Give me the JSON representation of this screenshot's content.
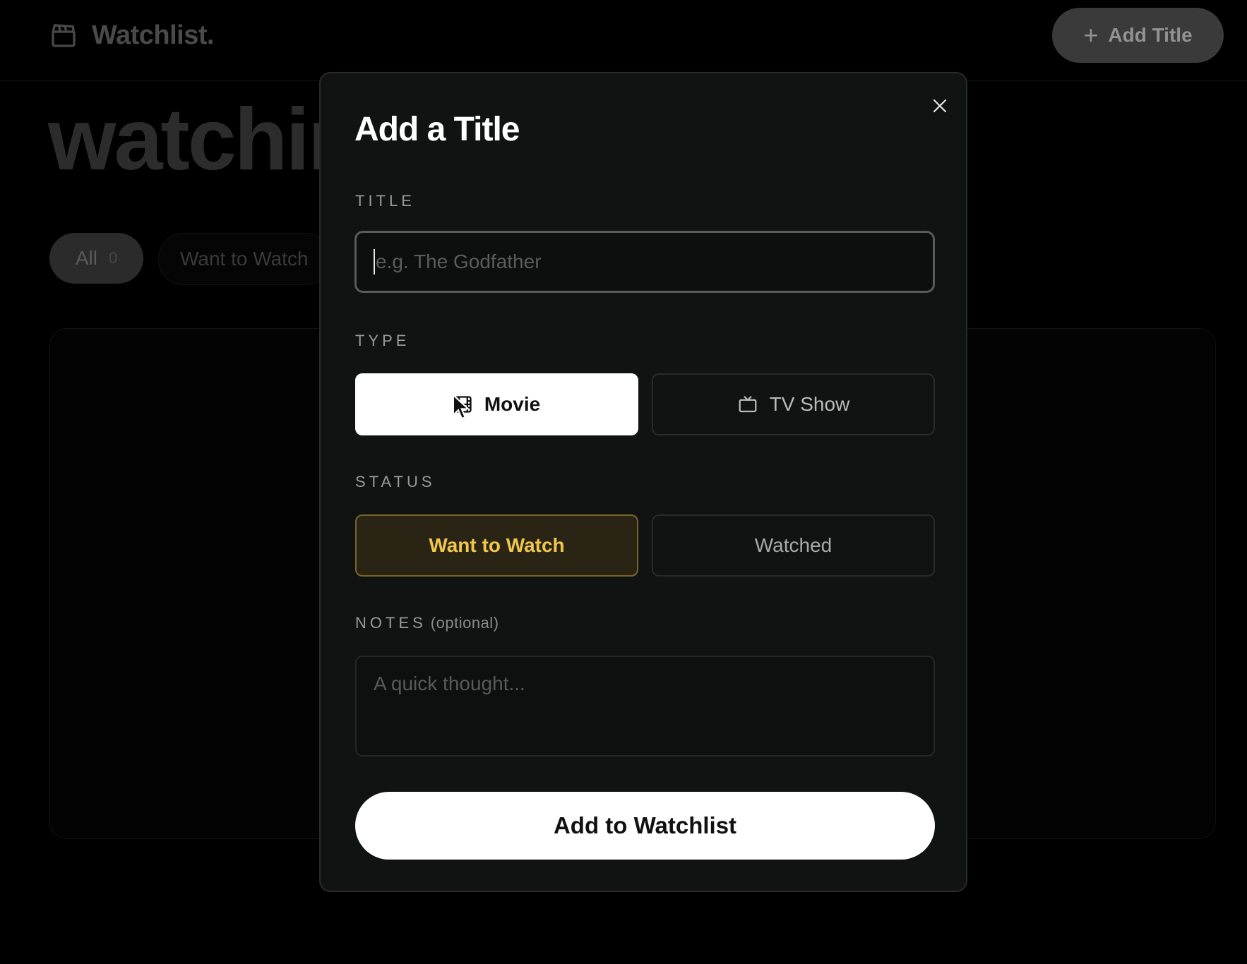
{
  "app": {
    "logo_text": "Watchlist.",
    "logo_icon": "clapperboard-icon",
    "add_title_label": "Add Title",
    "hero_fragment": "watchin"
  },
  "filters": [
    {
      "label": "All",
      "count": "0",
      "active": true
    },
    {
      "label": "Want to Watch"
    }
  ],
  "modal": {
    "title": "Add a Title",
    "close_icon": "close-icon",
    "fields": {
      "title_label": "TITLE",
      "title_placeholder": "e.g. The Godfather",
      "title_value": "",
      "type_label": "TYPE",
      "type_options": [
        {
          "label": "Movie",
          "icon": "film-icon",
          "selected": true
        },
        {
          "label": "TV Show",
          "icon": "tv-icon",
          "selected": false
        }
      ],
      "status_label": "STATUS",
      "status_options": [
        {
          "label": "Want to Watch",
          "selected": true
        },
        {
          "label": "Watched",
          "selected": false
        }
      ],
      "notes_label": "NOTES",
      "notes_optional": "(optional)",
      "notes_placeholder": "A quick thought..."
    },
    "submit_label": "Add to Watchlist"
  },
  "colors": {
    "background": "#000000",
    "modal_bg": "#111212",
    "accent_gold": "#f0c64c",
    "accent_gold_bg": "#2a2414",
    "selected_bg": "#ffffff"
  }
}
